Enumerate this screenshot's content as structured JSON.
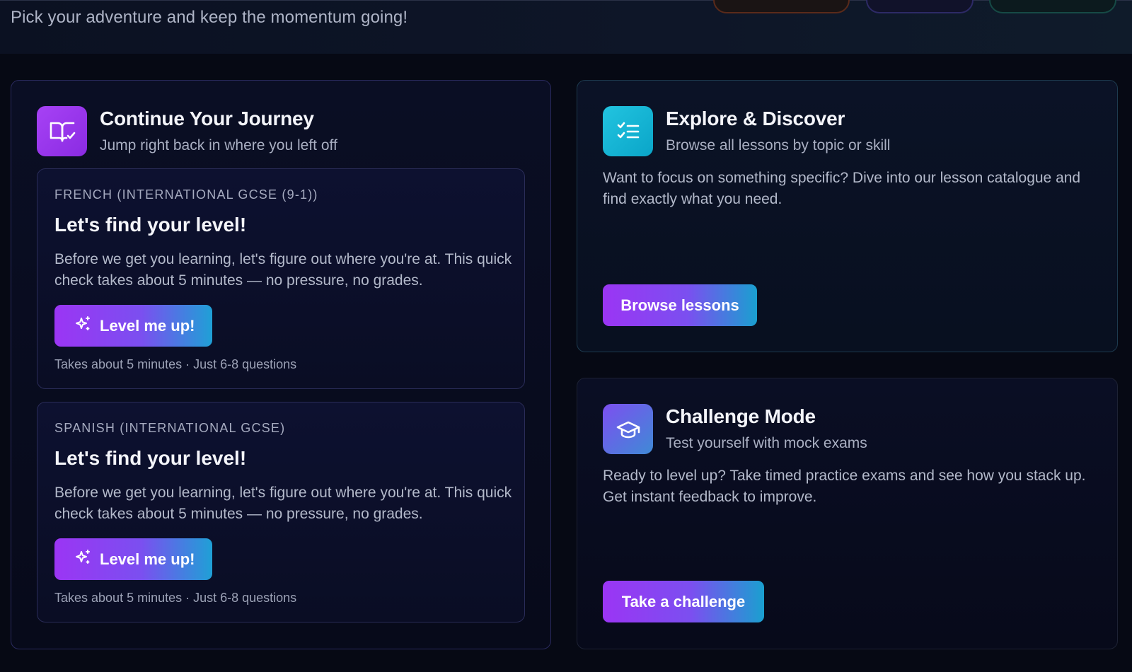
{
  "header": {
    "tagline": "Pick your adventure and keep the momentum going!"
  },
  "journey": {
    "icon": "book-check-icon",
    "title": "Continue Your Journey",
    "subtitle": "Jump right back in where you left off",
    "lessons": [
      {
        "subject": "FRENCH (INTERNATIONAL GCSE (9-1))",
        "heading": "Let's find your level!",
        "text": "Before we get you learning, let's figure out where you're at. This quick check takes about 5 minutes — no pressure, no grades.",
        "button_label": "Level me up!",
        "button_icon": "sparkles-icon",
        "meta": "Takes about 5 minutes · Just 6-8 questions"
      },
      {
        "subject": "SPANISH (INTERNATIONAL GCSE)",
        "heading": "Let's find your level!",
        "text": "Before we get you learning, let's figure out where you're at. This quick check takes about 5 minutes — no pressure, no grades.",
        "button_label": "Level me up!",
        "button_icon": "sparkles-icon",
        "meta": "Takes about 5 minutes · Just 6-8 questions"
      }
    ]
  },
  "explore": {
    "icon": "list-check-icon",
    "title": "Explore & Discover",
    "subtitle": "Browse all lessons by topic or skill",
    "description": "Want to focus on something specific? Dive into our lesson catalogue and find exactly what you need.",
    "button_label": "Browse lessons"
  },
  "challenge": {
    "icon": "graduation-cap-icon",
    "title": "Challenge Mode",
    "subtitle": "Test yourself with mock exams",
    "description": "Ready to level up? Take timed practice exams and see how you stack up. Get instant feedback to improve.",
    "button_label": "Take a challenge"
  },
  "colors": {
    "background": "#060914",
    "accent_purple": "#9b35f4",
    "accent_cyan": "#1fa0d6"
  }
}
